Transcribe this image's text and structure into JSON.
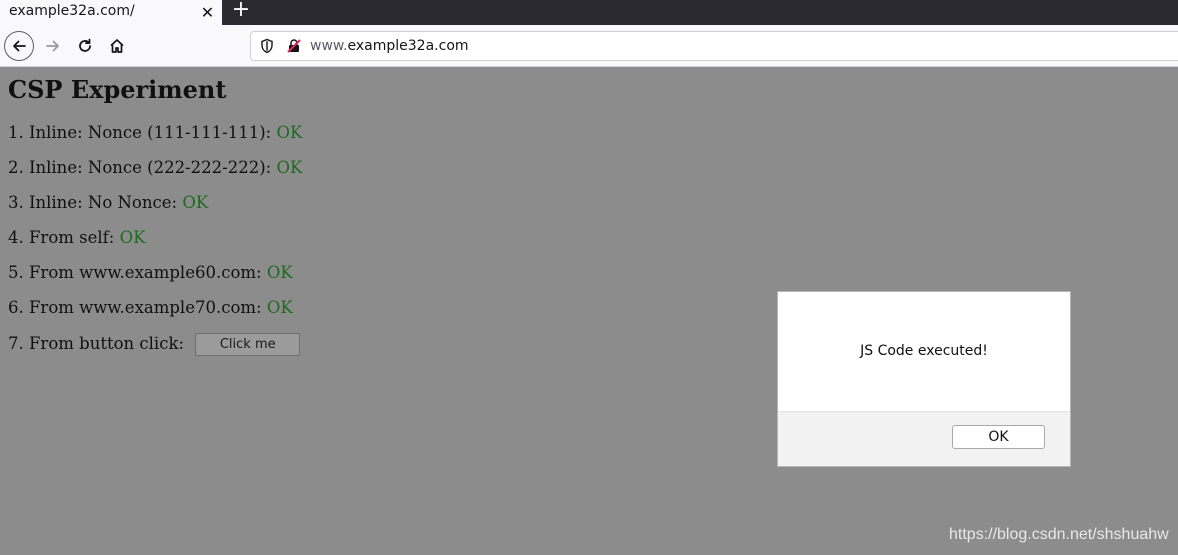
{
  "browser": {
    "tab_title": "example32a.com/",
    "tab_close_glyph": "✕",
    "new_tab_glyph": "+",
    "url_prefix": "www.",
    "url_domain": "example32a.com",
    "icons": [
      "back-arrow-icon",
      "forward-arrow-icon",
      "reload-icon",
      "home-icon",
      "shield-icon",
      "insecure-lock-icon"
    ]
  },
  "page": {
    "title": "CSP Experiment",
    "items": [
      {
        "label": "1. Inline: Nonce (111-111-111): ",
        "status": "OK"
      },
      {
        "label": "2. Inline: Nonce (222-222-222): ",
        "status": "OK"
      },
      {
        "label": "3. Inline: No Nonce: ",
        "status": "OK"
      },
      {
        "label": "4. From self: ",
        "status": "OK"
      },
      {
        "label": "5. From www.example60.com: ",
        "status": "OK"
      },
      {
        "label": "6. From www.example70.com: ",
        "status": "OK"
      },
      {
        "label": "7. From button click: ",
        "button": "Click me"
      }
    ],
    "status_color": "#1d6b1d"
  },
  "dialog": {
    "message": "JS Code executed!",
    "ok_label": "OK"
  },
  "watermark": "https://blog.csdn.net/shshuahw"
}
